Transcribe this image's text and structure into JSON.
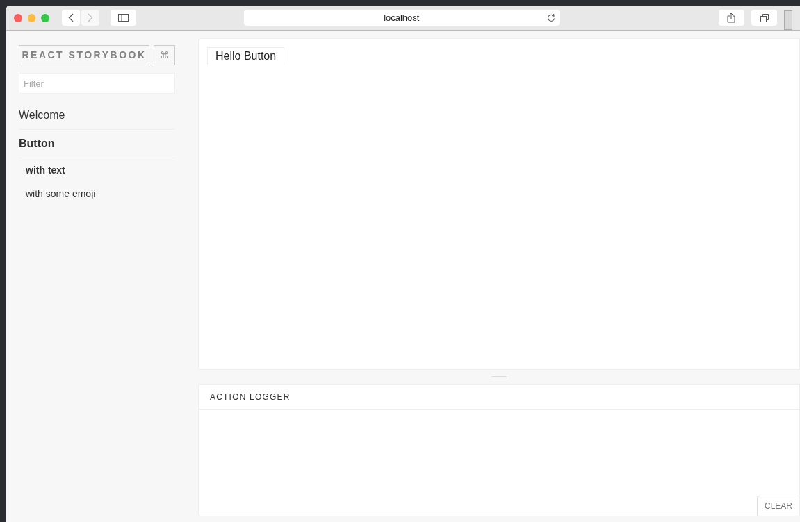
{
  "browser": {
    "address": "localhost"
  },
  "sidebar": {
    "title": "REACT STORYBOOK",
    "shortcut_key": "⌘",
    "filter": {
      "placeholder": "Filter"
    },
    "kinds": [
      {
        "label": "Welcome",
        "selected": false
      },
      {
        "label": "Button",
        "selected": true,
        "stories": [
          {
            "label": "with text",
            "selected": true
          },
          {
            "label": "with some emoji",
            "selected": false
          }
        ]
      }
    ]
  },
  "preview": {
    "button_label": "Hello Button"
  },
  "action_logger": {
    "title": "ACTION LOGGER",
    "clear_label": "CLEAR"
  }
}
